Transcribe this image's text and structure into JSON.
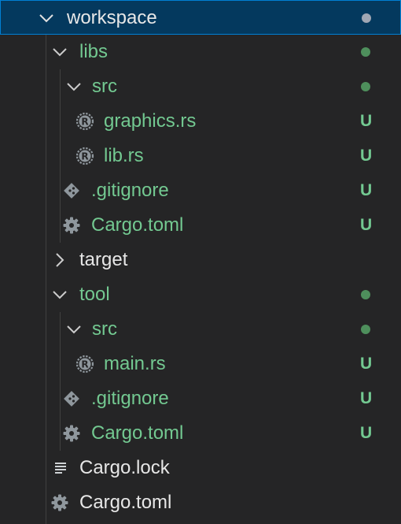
{
  "colors": {
    "background": "#252526",
    "selected_background": "#04395e",
    "selected_border": "#007fd4",
    "untracked_green": "#73c991",
    "dot_green": "#4e8f5c",
    "dot_grey": "#a0a7b4",
    "icon_grey": "#8f979d"
  },
  "tree": {
    "workspace": {
      "label": "workspace",
      "icon": "chevron-down-icon",
      "status": "grey-dot"
    },
    "libs": {
      "label": "libs",
      "icon": "chevron-down-icon",
      "status": "green-dot"
    },
    "libs_src": {
      "label": "src",
      "icon": "chevron-down-icon",
      "status": "green-dot"
    },
    "graphics_rs": {
      "label": "graphics.rs",
      "icon": "rust-icon",
      "badge": "U"
    },
    "lib_rs": {
      "label": "lib.rs",
      "icon": "rust-icon",
      "badge": "U"
    },
    "libs_gitignore": {
      "label": ".gitignore",
      "icon": "git-icon",
      "badge": "U"
    },
    "libs_cargo_toml": {
      "label": "Cargo.toml",
      "icon": "gear-icon",
      "badge": "U"
    },
    "target": {
      "label": "target",
      "icon": "chevron-right-icon"
    },
    "tool": {
      "label": "tool",
      "icon": "chevron-down-icon",
      "status": "green-dot"
    },
    "tool_src": {
      "label": "src",
      "icon": "chevron-down-icon",
      "status": "green-dot"
    },
    "main_rs": {
      "label": "main.rs",
      "icon": "rust-icon",
      "badge": "U"
    },
    "tool_gitignore": {
      "label": ".gitignore",
      "icon": "git-icon",
      "badge": "U"
    },
    "tool_cargo_toml": {
      "label": "Cargo.toml",
      "icon": "gear-icon",
      "badge": "U"
    },
    "cargo_lock": {
      "label": "Cargo.lock",
      "icon": "lines-icon"
    },
    "cargo_toml": {
      "label": "Cargo.toml",
      "icon": "gear-icon"
    }
  }
}
